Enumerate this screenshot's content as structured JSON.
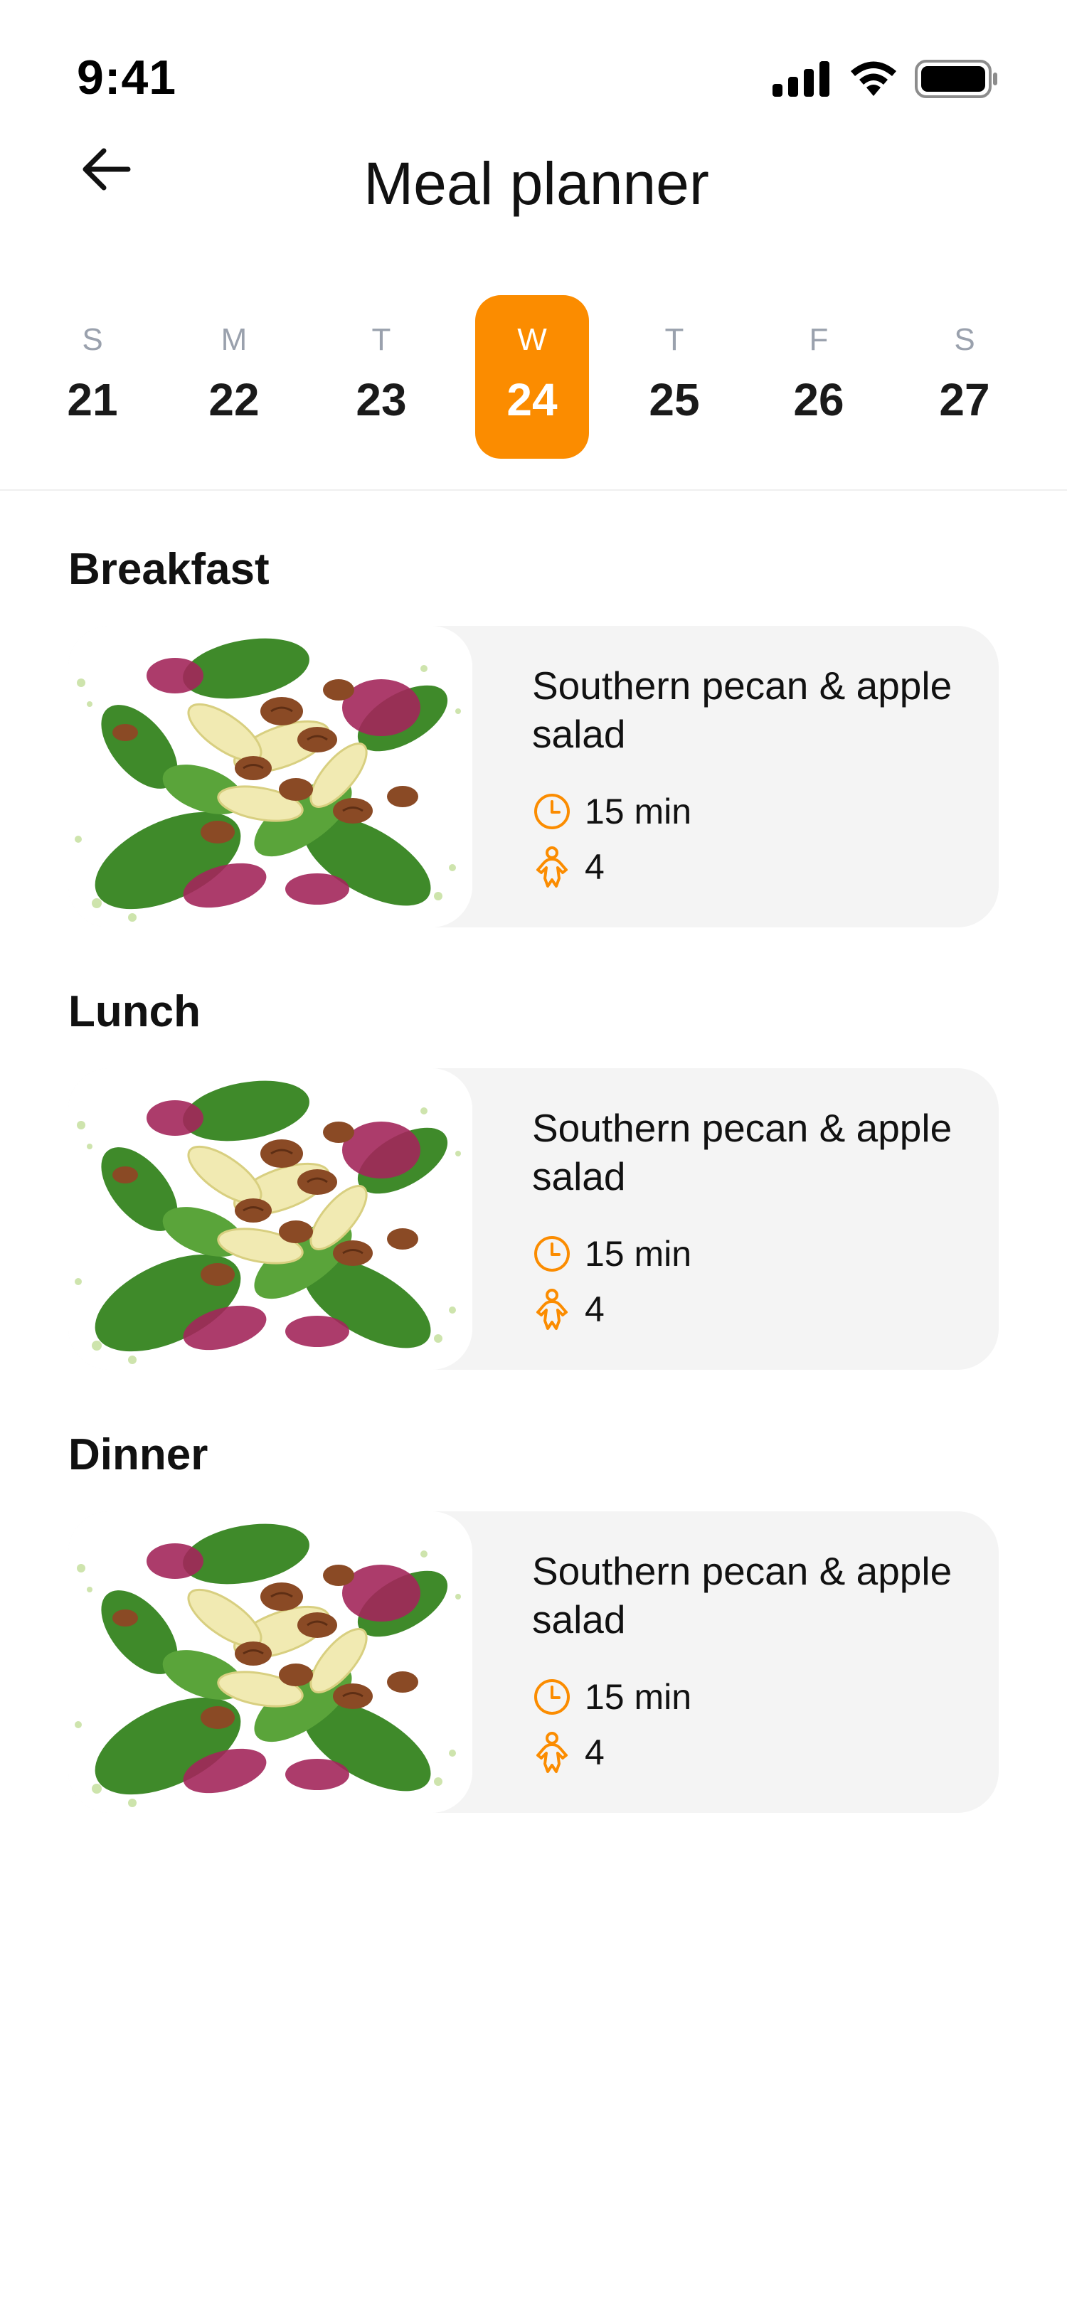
{
  "status_bar": {
    "time": "9:41",
    "icons": [
      "signal-icon",
      "wifi-icon",
      "battery-icon"
    ]
  },
  "header": {
    "back_icon": "arrow-left-icon",
    "title": "Meal planner"
  },
  "week": {
    "days": [
      {
        "letter": "S",
        "number": "21"
      },
      {
        "letter": "M",
        "number": "22"
      },
      {
        "letter": "T",
        "number": "23"
      },
      {
        "letter": "W",
        "number": "24",
        "selected": true
      },
      {
        "letter": "T",
        "number": "25"
      },
      {
        "letter": "F",
        "number": "26"
      },
      {
        "letter": "S",
        "number": "27"
      }
    ]
  },
  "meals": [
    {
      "section": "Breakfast",
      "name": "Southern pecan & apple salad",
      "time": "15 min",
      "servings": "4"
    },
    {
      "section": "Lunch",
      "name": "Southern pecan & apple salad",
      "time": "15 min",
      "servings": "4"
    },
    {
      "section": "Dinner",
      "name": "Southern pecan & apple salad",
      "time": "15 min",
      "servings": "4"
    }
  ],
  "colors": {
    "accent": "#fb8c00",
    "card_background": "#f4f4f4",
    "muted_text": "#9aa1ad"
  }
}
